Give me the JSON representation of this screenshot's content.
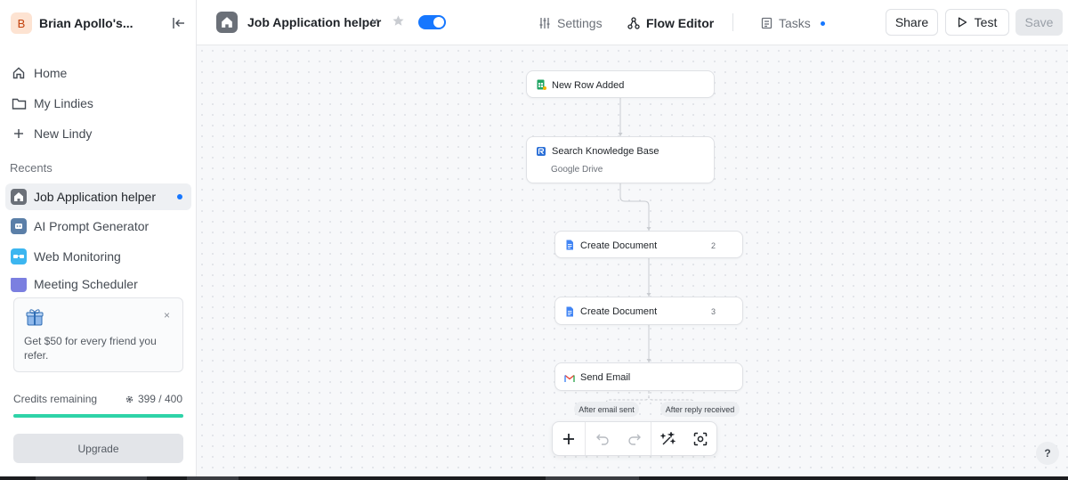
{
  "sidebar": {
    "workspace_initial": "B",
    "workspace_name": "Brian Apollo's...",
    "nav": [
      {
        "label": "Home",
        "icon": "home-icon"
      },
      {
        "label": "My Lindies",
        "icon": "folder-icon"
      },
      {
        "label": "New Lindy",
        "icon": "plus-icon"
      }
    ],
    "recents_label": "Recents",
    "recents": [
      {
        "label": "Job Application helper",
        "icon": "home-icon",
        "active": true,
        "unread": true
      },
      {
        "label": "AI Prompt Generator",
        "icon": "robot-icon",
        "active": false
      },
      {
        "label": "Web Monitoring",
        "icon": "glasses-icon",
        "active": false
      },
      {
        "label": "Meeting Scheduler",
        "icon": "calendar-icon",
        "active": false
      }
    ],
    "refer": {
      "text": "Get $50 for every friend you refer.",
      "close": "×"
    },
    "credits": {
      "label": "Credits remaining",
      "value": "399 / 400",
      "fraction": 0.9975
    },
    "upgrade_label": "Upgrade"
  },
  "topbar": {
    "title": "Job Application helper",
    "enabled": true,
    "tabs": [
      {
        "label": "Settings",
        "icon": "sliders-icon"
      },
      {
        "label": "Flow Editor",
        "icon": "flow-icon",
        "active": true
      },
      {
        "label": "Tasks",
        "icon": "clipboard-icon",
        "unread": true
      }
    ],
    "share_label": "Share",
    "test_label": "Test",
    "save_label": "Save"
  },
  "flow": {
    "nodes": [
      {
        "title": "New Row Added",
        "icon": "google-sheets-icon"
      },
      {
        "title": "Search Knowledge Base",
        "subtitle": "Google Drive",
        "icon": "knowledge-base-icon"
      },
      {
        "title": "Create Document",
        "badge": "2",
        "icon": "google-docs-icon"
      },
      {
        "title": "Create Document",
        "badge": "3",
        "icon": "google-docs-icon"
      },
      {
        "title": "Send Email",
        "icon": "gmail-icon"
      }
    ],
    "branches": [
      "After email sent",
      "After reply received"
    ]
  },
  "toolbar": {
    "tools": [
      "add-icon",
      "undo-icon",
      "redo-icon",
      "magic-wand-icon",
      "focus-icon"
    ]
  },
  "help_label": "?",
  "colors": {
    "accent": "#1677ff",
    "credits_bar": "#2ed3a8"
  }
}
